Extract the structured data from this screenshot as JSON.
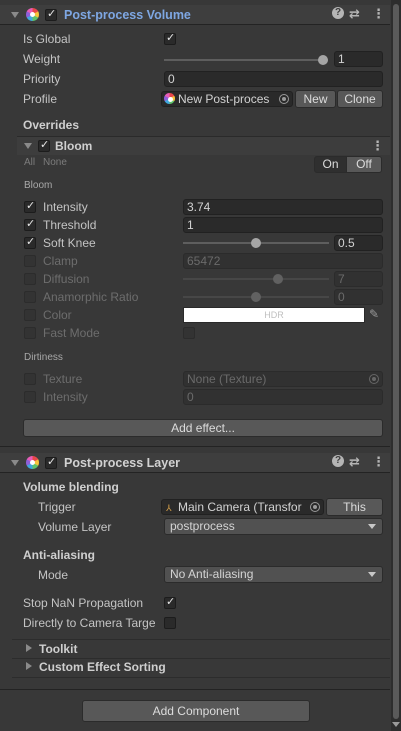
{
  "volume": {
    "title": "Post-process Volume",
    "is_global_label": "Is Global",
    "weight_label": "Weight",
    "weight_value": "1",
    "weight_fraction": 1.0,
    "priority_label": "Priority",
    "priority_value": "0",
    "profile_label": "Profile",
    "profile_value": "New Post-proces",
    "new_button": "New",
    "clone_button": "Clone",
    "overrides_label": "Overrides"
  },
  "bloom": {
    "title": "Bloom",
    "all_label": "All",
    "none_label": "None",
    "on_label": "On",
    "off_label": "Off",
    "section_bloom": "Bloom",
    "intensity_label": "Intensity",
    "intensity_value": "3.74",
    "threshold_label": "Threshold",
    "threshold_value": "1",
    "soft_knee_label": "Soft Knee",
    "soft_knee_value": "0.5",
    "soft_knee_fraction": 0.5,
    "clamp_label": "Clamp",
    "clamp_value": "65472",
    "diffusion_label": "Diffusion",
    "diffusion_value": "7",
    "diffusion_fraction": 0.6,
    "anamorphic_label": "Anamorphic Ratio",
    "anamorphic_value": "0",
    "anamorphic_fraction": 0.5,
    "color_label": "Color",
    "color_value_text": "HDR",
    "fast_mode_label": "Fast Mode",
    "section_dirtiness": "Dirtiness",
    "texture_label": "Texture",
    "texture_value": "None (Texture)",
    "dirt_intensity_label": "Intensity",
    "dirt_intensity_value": "0"
  },
  "add_effect_button": "Add effect...",
  "layer": {
    "title": "Post-process Layer",
    "volume_blending_label": "Volume blending",
    "trigger_label": "Trigger",
    "trigger_value": "Main Camera (Transfor",
    "this_button": "This",
    "volume_layer_label": "Volume Layer",
    "volume_layer_value": "postprocess",
    "anti_aliasing_label": "Anti-aliasing",
    "mode_label": "Mode",
    "mode_value": "No Anti-aliasing",
    "stop_nan_label": "Stop NaN Propagation",
    "direct_camera_label": "Directly to Camera Targe",
    "toolkit_label": "Toolkit",
    "custom_sorting_label": "Custom Effect Sorting"
  },
  "add_component_button": "Add Component",
  "icons": {
    "help": "help-icon",
    "settings": "preset-settings-icon",
    "menu": "kebab-menu-icon"
  },
  "colors": {
    "accent_title": "#7ea7e3",
    "panel": "#383838"
  }
}
